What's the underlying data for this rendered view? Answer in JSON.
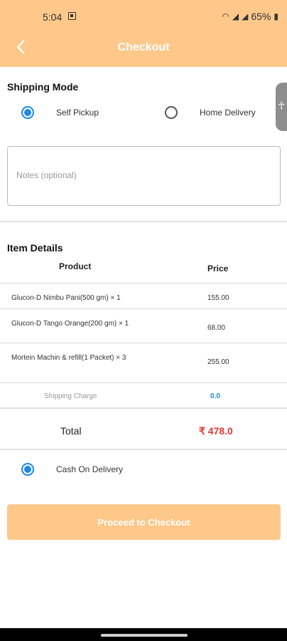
{
  "status_bar": {
    "time": "5:04",
    "battery": "65%",
    "icons": [
      "image-notification-icon",
      "wifi-calling-icon",
      "signal-icon-sim1",
      "signal-icon-sim2",
      "battery-icon"
    ]
  },
  "app_bar": {
    "title": "Checkout",
    "back_icon": "chevron-left-icon"
  },
  "shipping": {
    "title": "Shipping Mode",
    "options": [
      {
        "label": "Self Pickup",
        "selected": true
      },
      {
        "label": "Home Delivery",
        "selected": false
      }
    ],
    "notes_placeholder": "Notes (optional)",
    "notes_value": ""
  },
  "side_handle": {
    "icon": "accessibility-icon"
  },
  "items": {
    "title": "Item Details",
    "headers": {
      "product": "Product",
      "price": "Price"
    },
    "rows": [
      {
        "name": "Glucon-D Nimbu Pani(500 gm) × 1",
        "price": "155.00"
      },
      {
        "name": "Glucon-D Tango Orange(200 gm) × 1",
        "price": "68.00"
      },
      {
        "name": "Mortein Machin & refill(1 Packet) × 3",
        "price": "255.00"
      }
    ],
    "shipping_charge_label": "Shipping Charge",
    "shipping_charge_value": "0.0",
    "total_label": "Total",
    "total_value": "₹ 478.0"
  },
  "payment": {
    "options": [
      {
        "label": "Cash On Delivery",
        "selected": true
      }
    ]
  },
  "checkout_button": "Proceed to Checkout",
  "colors": {
    "accent": "#fdc88a",
    "radio": "#1e88e5",
    "total": "#e53935"
  }
}
